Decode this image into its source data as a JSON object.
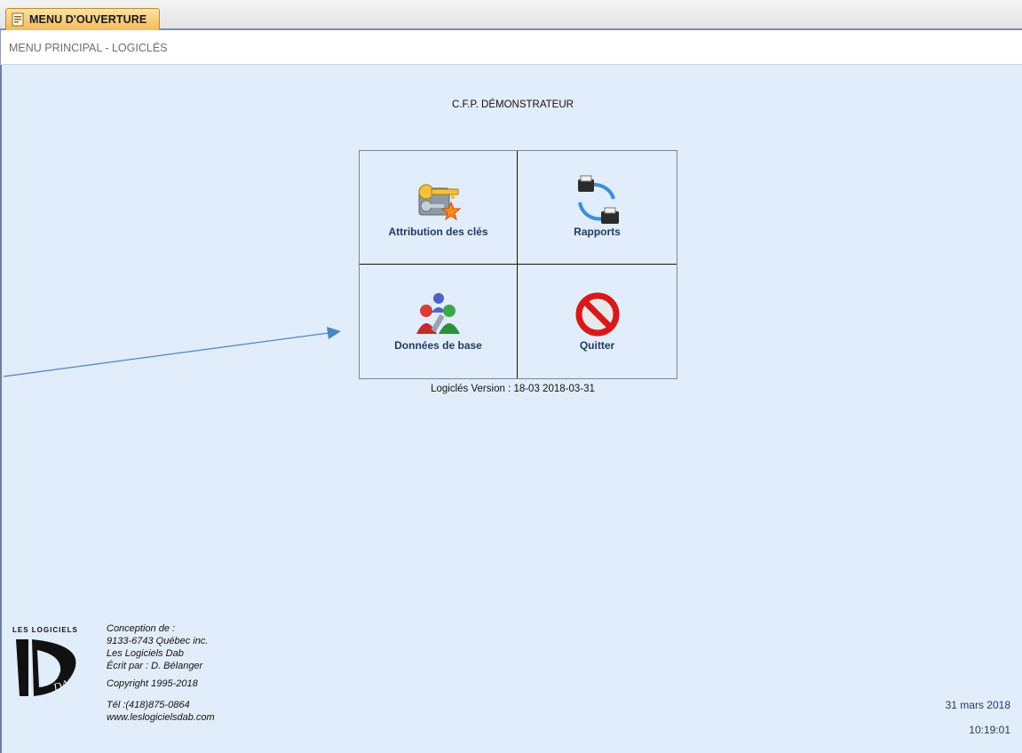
{
  "tab": {
    "label": "MENU D'OUVERTURE"
  },
  "header": {
    "title": "MENU PRINCIPAL - LOGICLÉS"
  },
  "main": {
    "organization": "C.F.P. DÉMONSTRATEUR",
    "menu": [
      {
        "label": "Attribution des clés",
        "icon": "keys-icon"
      },
      {
        "label": "Rapports",
        "icon": "printers-cycle-icon"
      },
      {
        "label": "Données de base",
        "icon": "users-icon"
      },
      {
        "label": "Quitter",
        "icon": "no-entry-icon"
      }
    ],
    "version": "Logiclés Version : 18-03  2018-03-31"
  },
  "footer": {
    "logo_text": "LES LOGICIELS",
    "logo_mark": "DAB",
    "credits": [
      "Conception de :",
      "9133-6743 Québec inc.",
      "Les Logiciels Dab",
      "Écrit par : D. Bélanger",
      "Copyright 1995-2018",
      "Tél :(418)875-0864",
      "www.leslogicielsdab.com"
    ],
    "date": "31 mars 2018",
    "time": "10:19:01"
  },
  "colors": {
    "background": "#e2edfb",
    "label_text": "#1f3b64",
    "tab": "#f3bd55",
    "arrow": "#4a86c0"
  }
}
